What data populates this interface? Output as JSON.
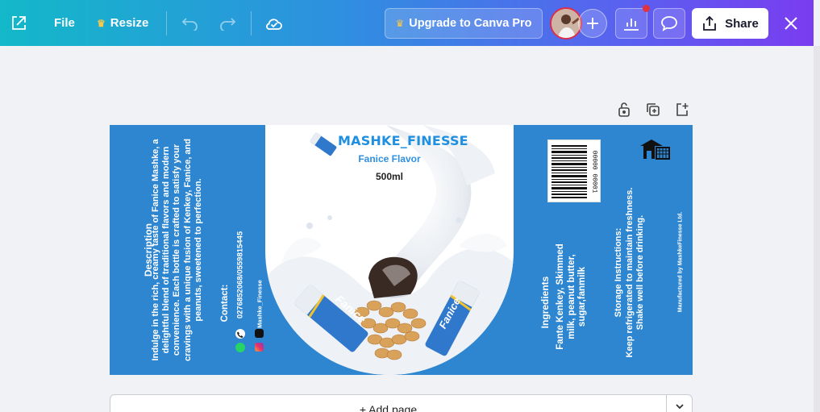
{
  "toolbar": {
    "file_label": "File",
    "resize_label": "Resize",
    "upgrade_label": "Upgrade to Canva Pro",
    "share_label": "Share"
  },
  "design": {
    "description_title": "Description",
    "description_lines": [
      "Indulge in the rich, creamy taste of Fanice Mashke, a",
      "delightful blend of traditional flavors and modern",
      "convenience. Each bottle is crafted to satisfy your",
      "cravings with a unique fusion of Kenkey, Fanice, and",
      "peanuts, sweetened to perfection."
    ],
    "contact_title": "Contact:",
    "contact_phone": "0276852068/0559815445",
    "contact_social": "Mashke_Finesse",
    "brand_name": "MASHKE_FINESSE",
    "flavor": "Fanice Flavor",
    "volume": "500ml",
    "wrapper_text": "Fanice",
    "barcode_number": "00000 00001",
    "ingredients_title": "Ingredients",
    "ingredients_lines": [
      "Fante Kenkey, Skimmed",
      "milk, peanut butter,",
      "sugar,fanmilk"
    ],
    "storage_lines": [
      "Storage Instructions:",
      "Keep refrigerated to maintain freshness.",
      "Shake well before drinking."
    ],
    "manufacturer": "Manufactured by MashkeFinesse Ltd."
  },
  "add_page_label": "+ Add page",
  "colors": {
    "panel_blue": "#2e86d1",
    "brand_blue": "#1f8fe0",
    "notification": "#e0323f"
  }
}
